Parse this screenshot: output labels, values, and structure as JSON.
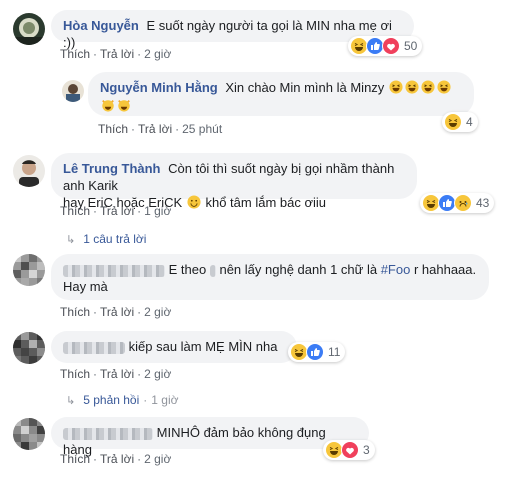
{
  "comments": [
    {
      "author": "Hòa Nguyễn",
      "text": "E suốt ngày người ta gọi là MIN nha mẹ ơi :))",
      "like": "Thích",
      "reply": "Trả lời",
      "time": "2 giờ",
      "reaction_count": "50",
      "reactions": [
        "haha-icon",
        "like-icon",
        "love-icon"
      ]
    },
    {
      "author": "Nguyễn Minh Hằng",
      "text": "Xin chào Min mình là Minzy",
      "like": "Thích",
      "reply": "Trả lời",
      "time": "25 phút",
      "reaction_count": "4",
      "reactions": [
        "haha-icon"
      ]
    },
    {
      "author": "Lê Trung Thành",
      "text_line1": "Còn tôi thì suốt ngày bị gọi nhầm thành anh Karik",
      "text_line2a": "hay EriC hoặc EriCK",
      "text_line2b": "khổ tâm lắm bác ơiiu",
      "like": "Thích",
      "reply": "Trả lời",
      "time": "1 giờ",
      "reaction_count": "43",
      "reactions": [
        "haha-icon",
        "like-icon",
        "sad-icon"
      ],
      "replies_label": "1 câu trả lời"
    },
    {
      "author": "",
      "text_line1_a": "E theo",
      "text_line1_b": "nên lấy nghệ danh 1 chữ là",
      "hashtag": "#Foo",
      "text_line1_c": "r hahhaaa.",
      "text_line2": "Hay mà",
      "like": "Thích",
      "reply": "Trả lời",
      "time": "2 giờ"
    },
    {
      "author": "",
      "text": "kiếp sau làm MẸ MÌN nha",
      "like": "Thích",
      "reply": "Trả lời",
      "time": "2 giờ",
      "reaction_count": "11",
      "reactions": [
        "haha-icon",
        "like-icon"
      ],
      "replies_label": "5 phản hồi",
      "replies_time": "1 giờ"
    },
    {
      "author": "",
      "text": "MINHÔ đảm bảo không đụng hàng",
      "like": "Thích",
      "reply": "Trả lời",
      "time": "2 giờ",
      "reaction_count": "3",
      "reactions": [
        "haha-icon",
        "love-icon"
      ]
    }
  ],
  "colors": {
    "link": "#385898",
    "bubble": "#f2f3f5",
    "meta": "#606770"
  }
}
